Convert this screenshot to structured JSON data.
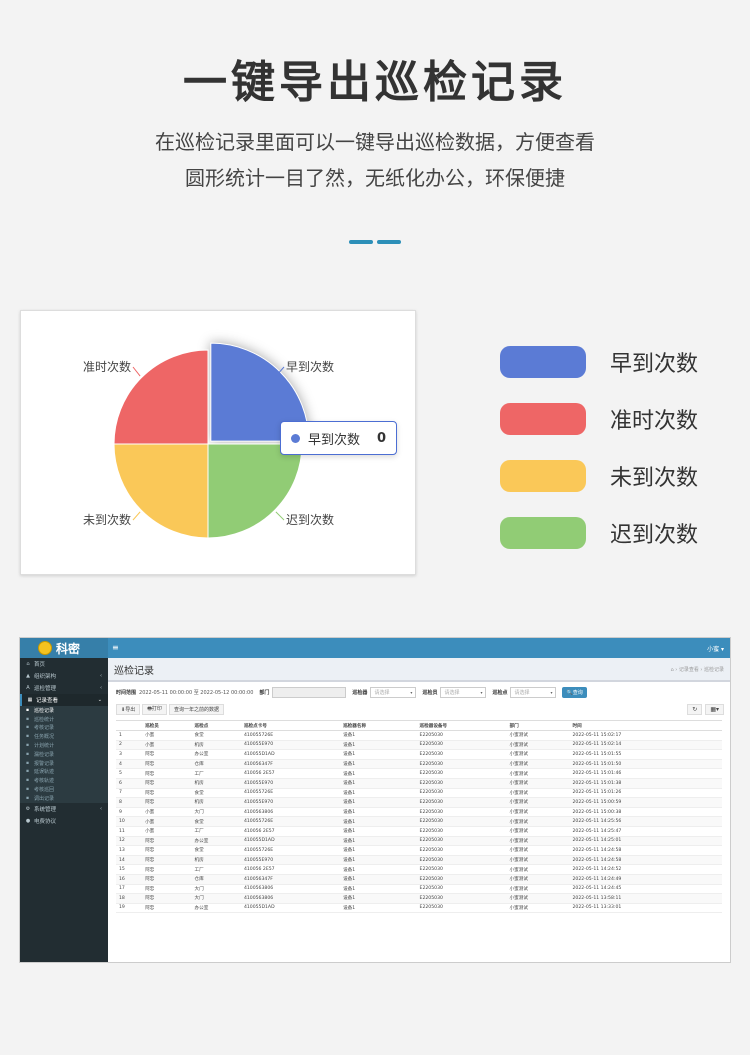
{
  "hero": {
    "title": "一键导出巡检记录",
    "desc_line1": "在巡检记录里面可以一键导出巡检数据，方便查看",
    "desc_line2": "圆形统计一目了然，无纸化办公，环保便捷"
  },
  "chart_data": {
    "type": "pie",
    "categories": [
      "早到次数",
      "迟到次数",
      "未到次数",
      "准时次数"
    ],
    "values": [
      1,
      1,
      1,
      1
    ],
    "colors": [
      "#5b7bd5",
      "#91cc75",
      "#fac858",
      "#ee6666"
    ],
    "tooltip": {
      "label": "早到次数",
      "value": "0"
    }
  },
  "legend": [
    {
      "label": "早到次数",
      "color": "#5b7bd5"
    },
    {
      "label": "准时次数",
      "color": "#ee6666"
    },
    {
      "label": "未到次数",
      "color": "#fac858"
    },
    {
      "label": "迟到次数",
      "color": "#91cc75"
    }
  ],
  "app": {
    "logo_text": "科密",
    "menu_toggle": "≡",
    "user": "小蜜 ▾",
    "sidebar": {
      "items": [
        {
          "icon": "home-icon",
          "glyph": "⌂",
          "label": "首页"
        },
        {
          "icon": "org-icon",
          "glyph": "▲",
          "label": "组织架构",
          "arrow": "‹"
        },
        {
          "icon": "patrol-icon",
          "glyph": "A",
          "label": "巡检管理",
          "arrow": "‹"
        },
        {
          "icon": "record-icon",
          "glyph": "▦",
          "label": "记录查看",
          "arrow": "⌄"
        }
      ],
      "sub_items": [
        {
          "label": "巡检记录",
          "current": true
        },
        {
          "label": "巡检统计"
        },
        {
          "label": "考核记录"
        },
        {
          "label": "任务概况"
        },
        {
          "label": "计划统计"
        },
        {
          "label": "漏检记录"
        },
        {
          "label": "报警记录"
        },
        {
          "label": "延误轨迹"
        },
        {
          "label": "考核轨迹"
        },
        {
          "label": "考核巡回"
        },
        {
          "label": "调出记录"
        }
      ],
      "bottom_items": [
        {
          "icon": "gear-icon",
          "glyph": "⚙",
          "label": "系统管理",
          "arrow": "‹"
        },
        {
          "icon": "dot-icon",
          "glyph": "●",
          "label": "电费协议"
        }
      ]
    },
    "page_title": "巡检记录",
    "breadcrumb": "⌂ › 记录查看 › 巡检记录",
    "filters": {
      "time_label": "时间范围",
      "time_value": "2022-05-11 00:00:00 至 2022-05-12 00:00:00",
      "dept_label": "部门",
      "patroller_label": "巡检器",
      "patroller_placeholder": "请选择",
      "route_label": "巡检员",
      "route_placeholder": "请选择",
      "point_label": "巡检点",
      "point_placeholder": "请选择",
      "query_button": "🔍查询"
    },
    "toolbar": {
      "export": "⬇导出",
      "print": "🖶打印",
      "query_year": "查询一年之前的数据",
      "refresh": "↻",
      "columns": "▦▾"
    },
    "table": {
      "headers": [
        "",
        "巡检员",
        "巡检点",
        "巡检点卡号",
        "巡检器名称",
        "巡检器设备号",
        "部门",
        "时间"
      ],
      "rows": [
        [
          "1",
          "小蜜",
          "食堂",
          "410055726E",
          "设备1",
          "E2205030",
          "小蜜测试",
          "2022-05-11 15:02:17"
        ],
        [
          "2",
          "小蜜",
          "机房",
          "410055E970",
          "设备1",
          "E2205030",
          "小蜜测试",
          "2022-05-11 15:02:14"
        ],
        [
          "3",
          "阿忠",
          "办公室",
          "410055D1AD",
          "设备1",
          "E2205030",
          "小蜜测试",
          "2022-05-11 15:01:55"
        ],
        [
          "4",
          "阿忠",
          "仓库",
          "410056347F",
          "设备1",
          "E2205030",
          "小蜜测试",
          "2022-05-11 15:01:50"
        ],
        [
          "5",
          "阿忠",
          "工厂",
          "410056 2E57",
          "设备1",
          "E2205030",
          "小蜜测试",
          "2022-05-11 15:01:46"
        ],
        [
          "6",
          "阿忠",
          "机房",
          "410055E970",
          "设备1",
          "E2205030",
          "小蜜测试",
          "2022-05-11 15:01:38"
        ],
        [
          "7",
          "阿忠",
          "食堂",
          "410055726E",
          "设备1",
          "E2205030",
          "小蜜测试",
          "2022-05-11 15:01:26"
        ],
        [
          "8",
          "阿忠",
          "机房",
          "410055E970",
          "设备1",
          "E2205030",
          "小蜜测试",
          "2022-05-11 15:00:59"
        ],
        [
          "9",
          "小蜜",
          "大门",
          "4100563806",
          "设备1",
          "E2205030",
          "小蜜测试",
          "2022-05-11 15:00:38"
        ],
        [
          "10",
          "小蜜",
          "食堂",
          "410055726E",
          "设备1",
          "E2205030",
          "小蜜测试",
          "2022-05-11 14:25:56"
        ],
        [
          "11",
          "小蜜",
          "工厂",
          "410056 2E57",
          "设备1",
          "E2205030",
          "小蜜测试",
          "2022-05-11 14:25:47"
        ],
        [
          "12",
          "阿忠",
          "办公室",
          "410055D1AD",
          "设备1",
          "E2205030",
          "小蜜测试",
          "2022-05-11 14:25:01"
        ],
        [
          "13",
          "阿忠",
          "食堂",
          "410055726E",
          "设备1",
          "E2205030",
          "小蜜测试",
          "2022-05-11 14:24:58"
        ],
        [
          "14",
          "阿忠",
          "机房",
          "410055E970",
          "设备1",
          "E2205030",
          "小蜜测试",
          "2022-05-11 14:24:58"
        ],
        [
          "15",
          "阿忠",
          "工厂",
          "410056 2E57",
          "设备1",
          "E2205030",
          "小蜜测试",
          "2022-05-11 14:24:52"
        ],
        [
          "16",
          "阿忠",
          "仓库",
          "410056347F",
          "设备1",
          "E2205030",
          "小蜜测试",
          "2022-05-11 14:24:49"
        ],
        [
          "17",
          "阿忠",
          "大门",
          "4100563806",
          "设备1",
          "E2205030",
          "小蜜测试",
          "2022-05-11 14:24:45"
        ],
        [
          "18",
          "阿忠",
          "大门",
          "4100563806",
          "设备1",
          "E2205030",
          "小蜜测试",
          "2022-05-11 13:58:11"
        ],
        [
          "19",
          "阿忠",
          "办公室",
          "410055D1AD",
          "设备1",
          "E2205030",
          "小蜜测试",
          "2022-05-11 13:33:01"
        ]
      ]
    }
  }
}
